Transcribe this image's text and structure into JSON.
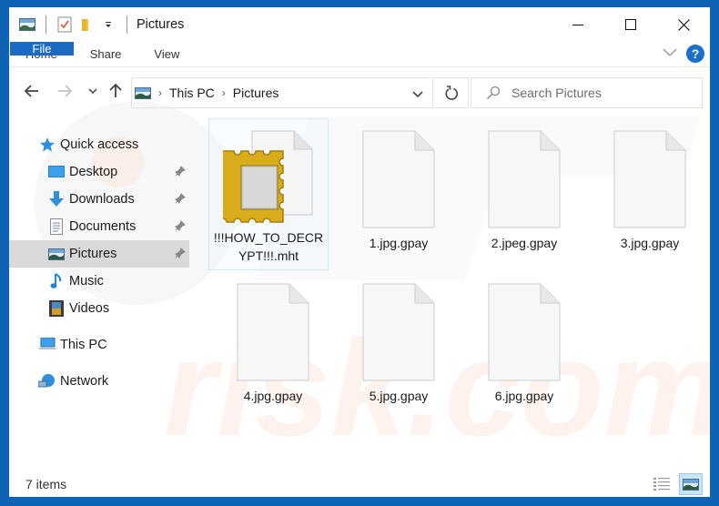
{
  "window": {
    "title": "Pictures",
    "controls": {
      "minimize": "minimize",
      "maximize": "maximize",
      "close": "close"
    }
  },
  "quick_access_toolbar": {
    "icons": [
      "pictures-folder-icon",
      "properties-icon",
      "new-folder-icon",
      "customize-dropdown-icon"
    ]
  },
  "ribbon": {
    "tabs": [
      {
        "label": "File",
        "active": true
      },
      {
        "label": "Home"
      },
      {
        "label": "Share"
      },
      {
        "label": "View"
      }
    ],
    "help_label": "?"
  },
  "navigation": {
    "breadcrumb": [
      "This PC",
      "Pictures"
    ],
    "search_placeholder": "Search Pictures"
  },
  "sidebar": {
    "items": [
      {
        "label": "Quick access",
        "icon": "star-icon",
        "level": 0
      },
      {
        "label": "Desktop",
        "icon": "desktop-icon",
        "level": 1,
        "pinned": true
      },
      {
        "label": "Downloads",
        "icon": "downloads-icon",
        "level": 1,
        "pinned": true
      },
      {
        "label": "Documents",
        "icon": "documents-icon",
        "level": 1,
        "pinned": true
      },
      {
        "label": "Pictures",
        "icon": "pictures-icon",
        "level": 1,
        "pinned": true,
        "selected": true
      },
      {
        "label": "Music",
        "icon": "music-icon",
        "level": 1
      },
      {
        "label": "Videos",
        "icon": "videos-icon",
        "level": 1
      },
      {
        "label": "This PC",
        "icon": "this-pc-icon",
        "level": 0
      },
      {
        "label": "Network",
        "icon": "network-icon",
        "level": 0
      }
    ]
  },
  "files": [
    {
      "name": "!!!HOW_TO_DECRYPT!!!.mht",
      "type": "mht",
      "selected": true
    },
    {
      "name": "1.jpg.gpay",
      "type": "blank"
    },
    {
      "name": "2.jpeg.gpay",
      "type": "blank"
    },
    {
      "name": "3.jpg.gpay",
      "type": "blank"
    },
    {
      "name": "4.jpg.gpay",
      "type": "blank"
    },
    {
      "name": "5.jpg.gpay",
      "type": "blank"
    },
    {
      "name": "6.jpg.gpay",
      "type": "blank"
    }
  ],
  "status": {
    "item_count": "7 items",
    "view_modes": [
      {
        "name": "details-view",
        "active": false
      },
      {
        "name": "large-icons-view",
        "active": true
      }
    ]
  },
  "colors": {
    "frame": "#0e63b4",
    "file_tab": "#1b6ac4",
    "selected_nav": "#d9d9d9",
    "help": "#1a6fcb"
  }
}
